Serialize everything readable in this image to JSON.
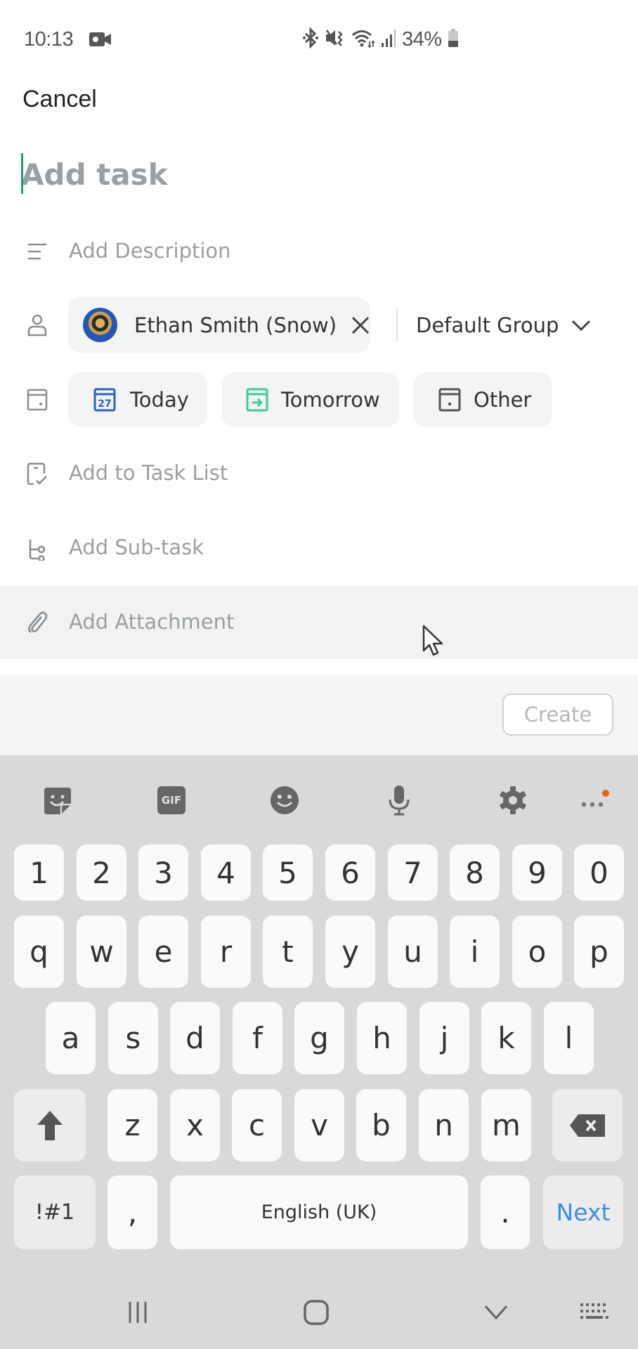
{
  "status_bar": {
    "time": "10:13",
    "battery_percent": "34%",
    "icons": [
      "video-record-icon",
      "bluetooth-icon",
      "vibrate-icon",
      "wifi-icon",
      "signal-icon",
      "battery-icon"
    ]
  },
  "header": {
    "cancel_label": "Cancel"
  },
  "task": {
    "title_placeholder": "Add task",
    "title_value": "",
    "description_label": "Add Description",
    "assignee": {
      "name": "Ethan Smith (Snow)"
    },
    "group": {
      "selected": "Default Group"
    },
    "dates": [
      {
        "label": "Today",
        "icon": "calendar-today-icon",
        "day": "27",
        "color": "#2f5fc4"
      },
      {
        "label": "Tomorrow",
        "icon": "calendar-tomorrow-icon",
        "color": "#3ec9a0"
      },
      {
        "label": "Other",
        "icon": "calendar-other-icon",
        "color": "#555555"
      }
    ],
    "task_list_label": "Add to Task List",
    "subtask_label": "Add Sub-task",
    "attachment_label": "Add Attachment"
  },
  "footer": {
    "create_label": "Create"
  },
  "keyboard": {
    "toolbar": [
      "sticker-icon",
      "gif-icon",
      "emoji-icon",
      "microphone-icon",
      "settings-icon",
      "more-icon"
    ],
    "gif_label": "GIF",
    "number_row": [
      "1",
      "2",
      "3",
      "4",
      "5",
      "6",
      "7",
      "8",
      "9",
      "0"
    ],
    "row1": [
      "q",
      "w",
      "e",
      "r",
      "t",
      "y",
      "u",
      "i",
      "o",
      "p"
    ],
    "row2": [
      "a",
      "s",
      "d",
      "f",
      "g",
      "h",
      "j",
      "k",
      "l"
    ],
    "row3": [
      "z",
      "x",
      "c",
      "v",
      "b",
      "n",
      "m"
    ],
    "symbols_label": "!#1",
    "comma_label": ",",
    "space_label": "English (UK)",
    "period_label": ".",
    "action_label": "Next",
    "notification_dot_color": "#e8611a"
  },
  "nav_bar": [
    "recent-apps-icon",
    "home-icon",
    "hide-keyboard-icon",
    "keyboard-switch-icon"
  ]
}
